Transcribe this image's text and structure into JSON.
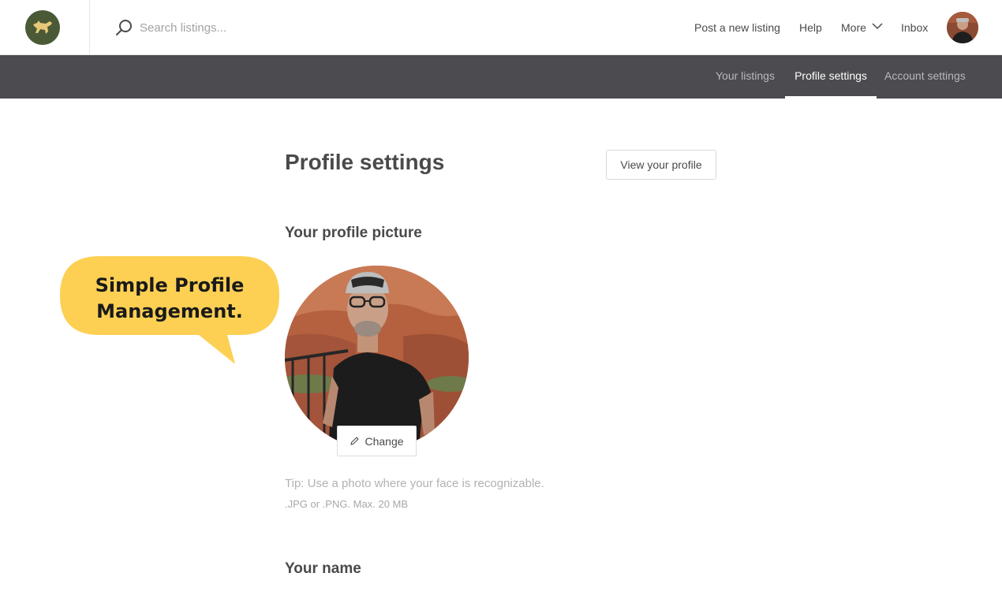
{
  "header": {
    "logo_icon": "dog-logo-icon",
    "search": {
      "placeholder": "Search listings...",
      "value": ""
    },
    "nav": {
      "post_listing": "Post a new listing",
      "help": "Help",
      "more": "More",
      "inbox": "Inbox"
    }
  },
  "subnav": {
    "tabs": [
      {
        "label": "Your listings",
        "active": false
      },
      {
        "label": "Profile settings",
        "active": true
      },
      {
        "label": "Account settings",
        "active": false
      }
    ]
  },
  "main": {
    "title": "Profile settings",
    "view_profile_label": "View your profile",
    "picture_section_title": "Your profile picture",
    "change_label": "Change",
    "tip": "Tip: Use a photo where your face is recognizable.",
    "formats": ".JPG or .PNG. Max. 20 MB",
    "name_section_title": "Your name"
  },
  "callout": {
    "line1": "Simple Profile",
    "line2": "Management.",
    "color": "#fdd054"
  },
  "colors": {
    "subnav_bg": "#4b4b50",
    "logo_bg": "#4b5a36",
    "logo_accent": "#e8c878"
  }
}
